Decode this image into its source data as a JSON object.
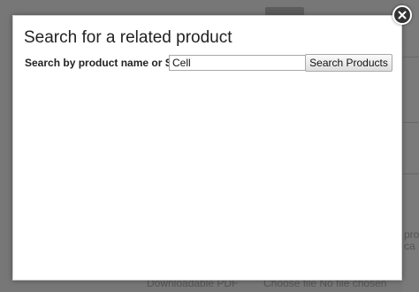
{
  "background": {
    "text_bottom_left": "Downloadable PDF",
    "text_bottom_right": "Choose file  No file chosen",
    "text_right_1": "pro",
    "text_right_2": "ca"
  },
  "modal": {
    "title": "Search for a related product",
    "search_label": "Search by product name or SKU",
    "search_value": "Cell",
    "search_button_label": "Search Products",
    "close_icon": "close-icon"
  }
}
